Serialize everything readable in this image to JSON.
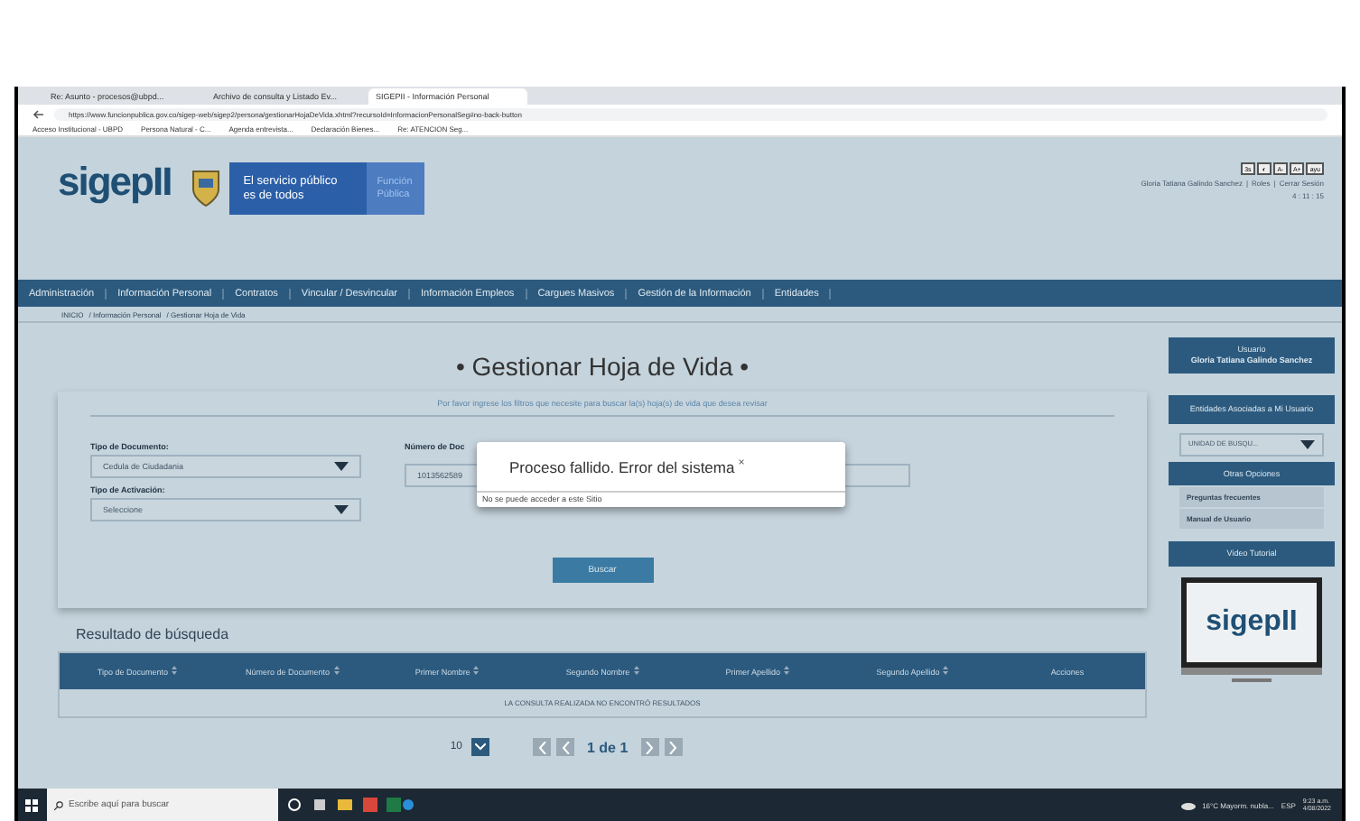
{
  "browser": {
    "tabs": [
      {
        "label": "Re: Asunto - procesos@ubpd...",
        "selected": false
      },
      {
        "label": "Archivo de consulta y Listado Ev...",
        "selected": false
      },
      {
        "label": "SIGEPII - Información Personal",
        "selected": true
      }
    ],
    "url": "https://www.funcionpublica.gov.co/sigep-web/sigep2/persona/gestionarHojaDeVida.xhtml?recursoId=InformacionPersonalSeg#no-back-button",
    "bookmarks": [
      "Acceso Institucional - UBPD",
      "Persona Natural - C...",
      "Agenda entrevista...",
      "Declaración Bienes...",
      "Re: ATENCION Seg..."
    ]
  },
  "header": {
    "logo": "sigepII",
    "slogan": "El servicio público es de todos",
    "agency": "Función Pública",
    "access_buttons": [
      "3s",
      "◐",
      "A-",
      "A+",
      "ayu"
    ],
    "user": "Gloria Tatiana Galindo Sanchez",
    "link_separator": "|",
    "links": [
      "Roles",
      "Cerrar Sesión"
    ],
    "timer": "4 : 11 : 15"
  },
  "nav": [
    "Administración",
    "Información Personal",
    "Contratos",
    "Vincular / Desvincular",
    "Información Empleos",
    "Cargues Masivos",
    "Gestión de la Información",
    "Entidades"
  ],
  "breadcrumb": [
    "INICIO",
    "/ Información Personal",
    "/ Gestionar Hoja de Vida"
  ],
  "title": "• Gestionar Hoja de Vida •",
  "instructions": "Por favor ingrese los filtros que necesite para buscar la(s) hoja(s) de vida que desea revisar",
  "form": {
    "doc_type": {
      "label": "Tipo de Documento:",
      "value": "Cedula de Ciudadania"
    },
    "doc_number": {
      "label": "Número de Doc",
      "value": "1013562589"
    },
    "activation": {
      "label": "Tipo de Activación:",
      "value": "Seleccione"
    },
    "search_button": "Buscar"
  },
  "dialog": {
    "title": "Proceso fallido. Error del sistema",
    "close": "×",
    "message": "No se puede acceder a este Sitio"
  },
  "results": {
    "heading": "Resultado de búsqueda",
    "columns": [
      {
        "label": "Tipo de Documento",
        "sortable": true
      },
      {
        "label": "Número de Documento",
        "sortable": true
      },
      {
        "label": "Primer Nombre",
        "sortable": true
      },
      {
        "label": "Segundo Nombre",
        "sortable": true
      },
      {
        "label": "Primer Apellido",
        "sortable": true
      },
      {
        "label": "Segundo Apellido",
        "sortable": true
      },
      {
        "label": "Acciones",
        "sortable": false
      }
    ],
    "empty": "LA CONSULTA REALIZADA NO ENCONTRÓ RESULTADOS",
    "page_size": "10",
    "page": "1 de 1"
  },
  "sidebar": {
    "user_heading": "Usuario",
    "user_name": "Gloria Tatiana Galindo Sanchez",
    "entities_heading": "Entidades Asociadas a Mi Usuario",
    "entity": "UNIDAD DE BUSQU...",
    "options_heading": "Otras Opciones",
    "options": [
      "Preguntas frecuentes",
      "Manual de Usuario"
    ],
    "video_heading": "Video Tutorial",
    "video_logo": "sigepII"
  },
  "taskbar": {
    "search_placeholder": "Escribe aquí para buscar",
    "weather": "16°C Mayorm. nubla...",
    "language": "ESP",
    "time": "9:23 a.m.",
    "date": "4/08/2022"
  }
}
